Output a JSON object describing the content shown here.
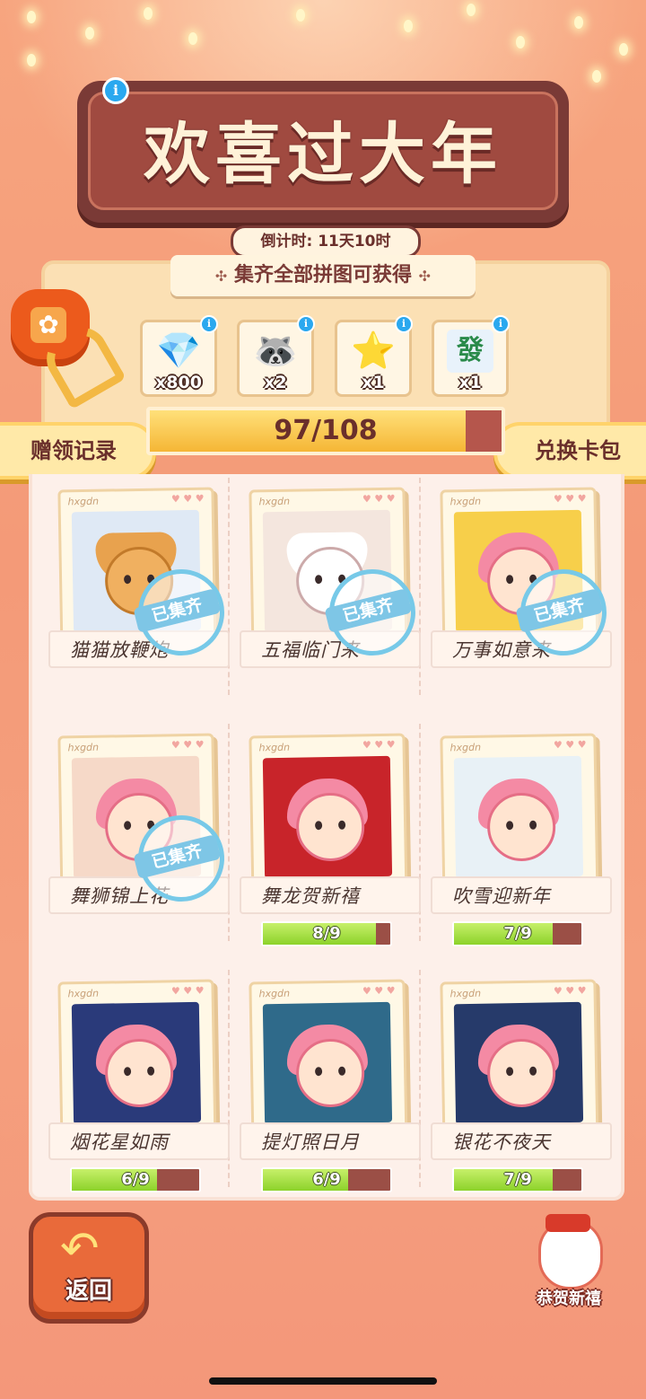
{
  "header": {
    "title": "欢喜过大年",
    "info_icon": "i",
    "countdown": "倒计时: 11天10时"
  },
  "rewards": {
    "title": "集齐全部拼图可获得",
    "title_decoration": "✣",
    "items": [
      {
        "icon": "diamond-icon",
        "glyph": "💎",
        "count": "x800"
      },
      {
        "icon": "raccoon-pet-icon",
        "glyph": "🦝",
        "count": "x2"
      },
      {
        "icon": "star-card-icon",
        "glyph": "⭐",
        "count": "x1"
      },
      {
        "icon": "mahjong-fa-tile-icon",
        "glyph": "發",
        "count": "x1"
      }
    ]
  },
  "collection_progress": {
    "current": 97,
    "total": 108,
    "text": "97/108"
  },
  "buttons": {
    "gift_record": "赠领记录",
    "exchange_pack": "兑换卡包",
    "back": "返回",
    "greetings": "恭贺新禧"
  },
  "card_brand": "hxgdn",
  "card_hearts": "♥ ♥ ♥",
  "stamp_text": "已集齐",
  "cards": [
    {
      "name": "猫猫放鞭炮",
      "collected": true,
      "art": "cat",
      "bg": "#dfe9f5"
    },
    {
      "name": "五福临门来",
      "collected": true,
      "art": "white-cat",
      "bg": "#f4e6de"
    },
    {
      "name": "万事如意来",
      "collected": true,
      "art": "girl",
      "bg": "#f7cf4a"
    },
    {
      "name": "舞狮锦上花",
      "collected": true,
      "art": "girl",
      "bg": "#f6d9c8"
    },
    {
      "name": "舞龙贺新禧",
      "collected": false,
      "progress": "8/9",
      "fraction": 0.889,
      "art": "girl",
      "bg": "#c8242a"
    },
    {
      "name": "吹雪迎新年",
      "collected": false,
      "progress": "7/9",
      "fraction": 0.778,
      "art": "girl",
      "bg": "#e8f1f6"
    },
    {
      "name": "烟花星如雨",
      "collected": false,
      "progress": "6/9",
      "fraction": 0.667,
      "art": "girl",
      "bg": "#2a3a7a"
    },
    {
      "name": "提灯照日月",
      "collected": false,
      "progress": "6/9",
      "fraction": 0.667,
      "art": "girl",
      "bg": "#2f6a8a"
    },
    {
      "name": "银花不夜天",
      "collected": false,
      "progress": "7/9",
      "fraction": 0.778,
      "art": "girl",
      "bg": "#263a6a"
    }
  ],
  "colors": {
    "accent": "#7a3a36",
    "progress_green": "#8cd22a",
    "stamp_blue": "#77c9e8"
  }
}
